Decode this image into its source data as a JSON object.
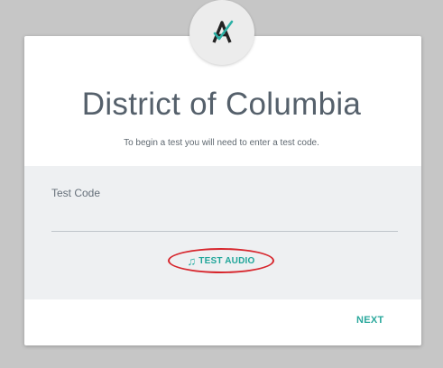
{
  "header": {
    "logo_icon": "a-check-logo-icon",
    "title": "District of Columbia",
    "subtitle": "To begin a test you will need to enter a test code."
  },
  "form": {
    "test_code_label": "Test Code",
    "test_code_value": ""
  },
  "actions": {
    "test_audio_icon": "music-note-icon",
    "test_audio_label": "TEST AUDIO",
    "next_label": "NEXT"
  },
  "colors": {
    "accent": "#21a69a",
    "highlight_ring": "#d7262d",
    "title_text": "#55606b"
  }
}
